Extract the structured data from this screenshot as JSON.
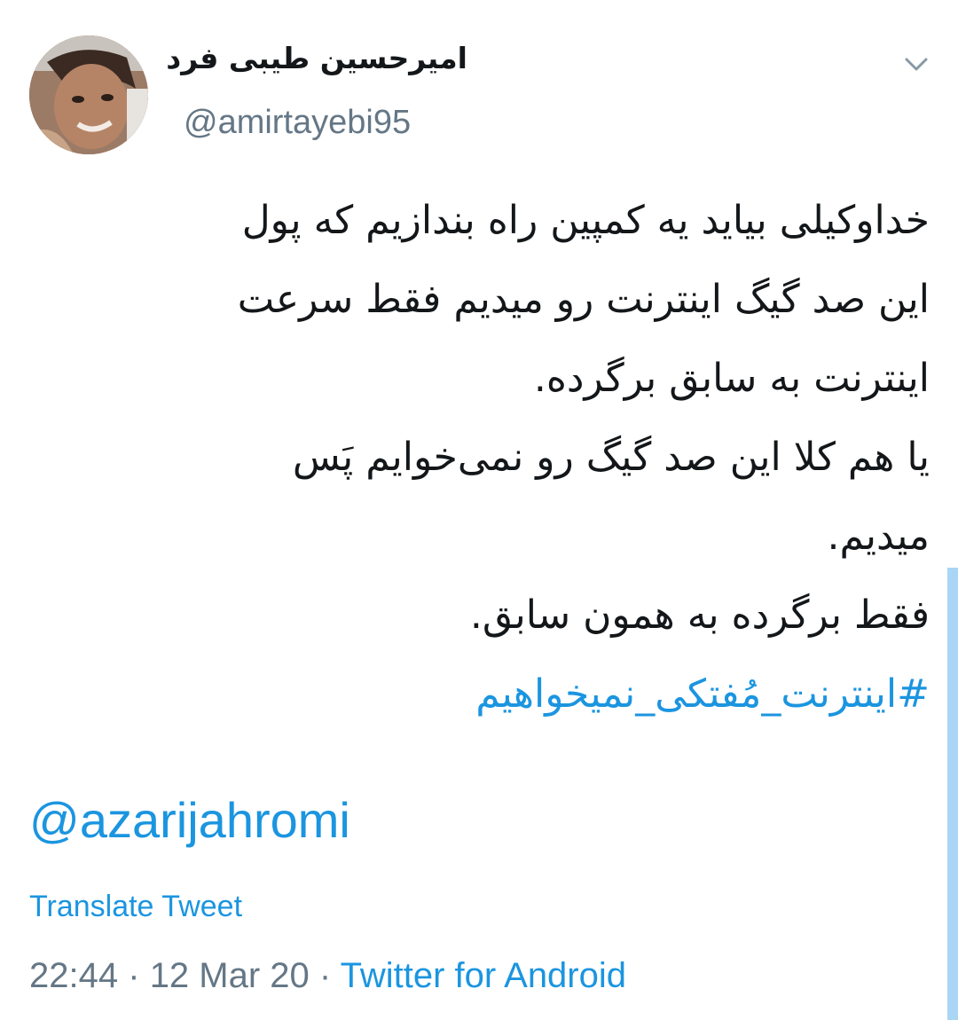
{
  "tweet": {
    "display_name": "امیرحسین طیبی فرد",
    "handle": "@amirtayebi95",
    "text_lines": [
      "خداوکیلی بیاید یه کمپین راه بندازیم که پول",
      "این صد گیگ اینترنت رو میدیم فقط سرعت",
      "اینترنت به سابق برگرده.",
      "یا هم کلا این صد گیگ رو نمی‌خوایم پَس",
      "میدیم.",
      "فقط برگرده به همون سابق."
    ],
    "hashtag": "#اینترنت_مُفتکی_نمیخواهیم",
    "mention": "@azarijahromi",
    "translate_label": "Translate Tweet",
    "time": "22:44",
    "date": "12 Mar 20",
    "separator": "·",
    "source": "Twitter for Android"
  },
  "icons": {
    "menu": "chevron-down-icon",
    "avatar": "profile-photo"
  },
  "colors": {
    "text": "#14171a",
    "secondary": "#657786",
    "link": "#1b95e0",
    "background": "#ffffff"
  }
}
